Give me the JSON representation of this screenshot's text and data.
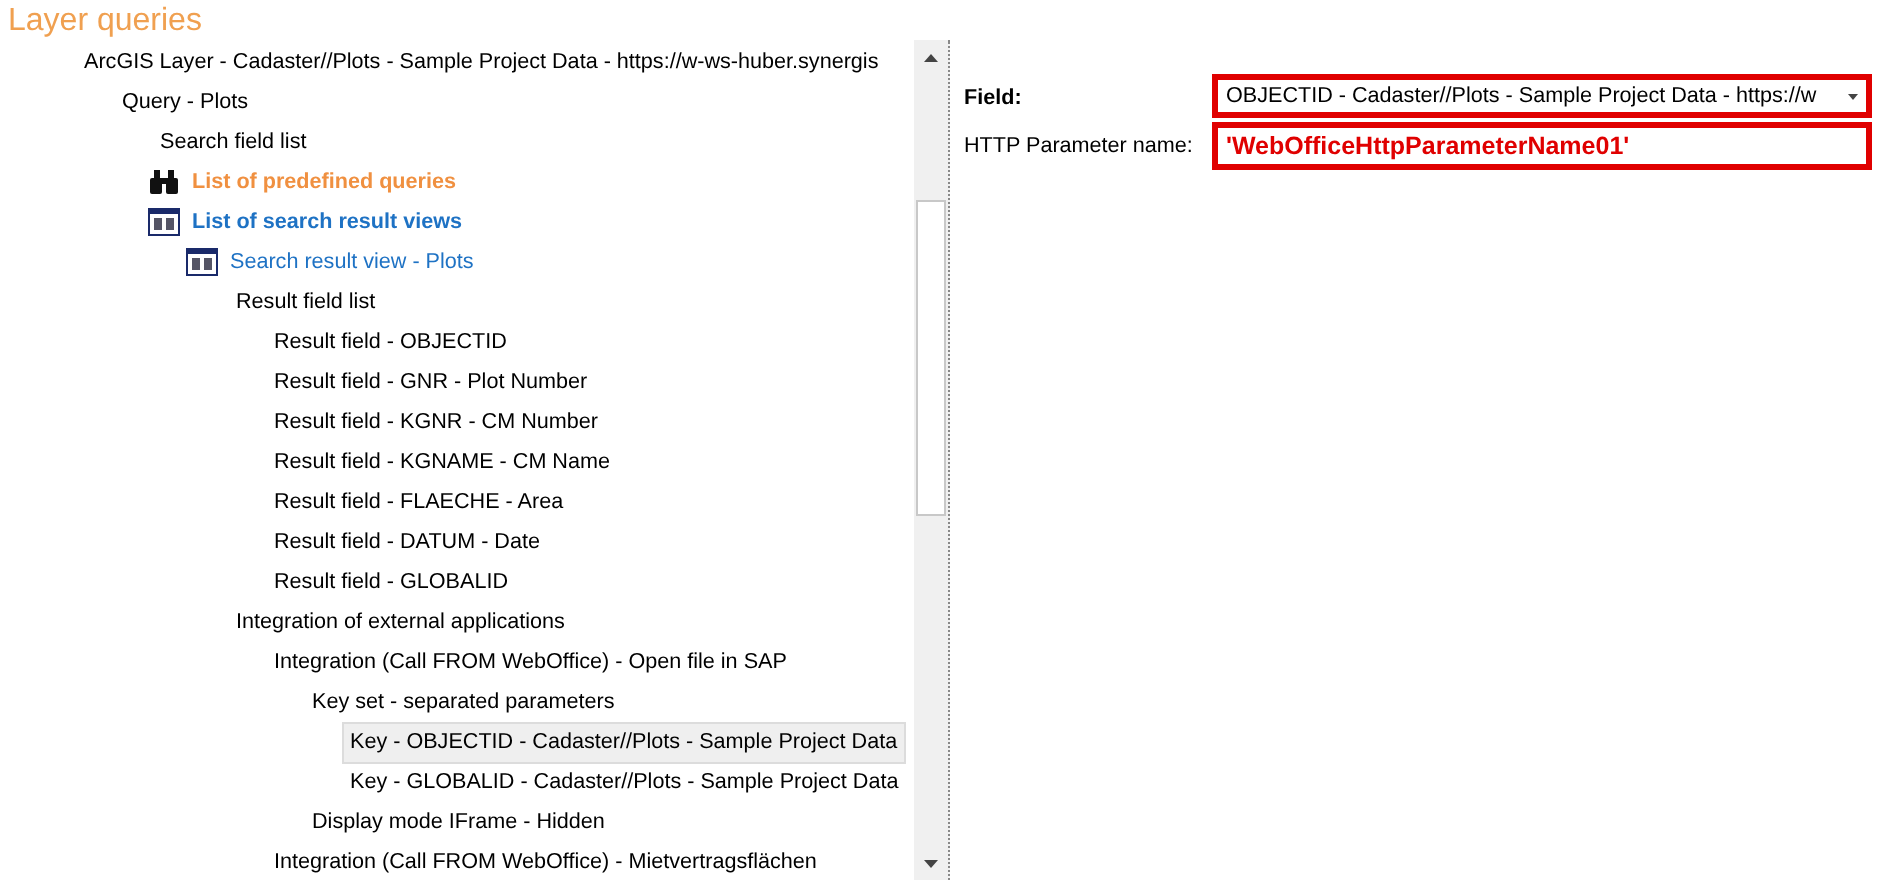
{
  "title": "Layer queries",
  "tree": [
    {
      "label": "ArcGIS Layer - Cadaster//Plots - Sample Project Data - https://w-ws-huber.synergis",
      "kind": "plain",
      "selected": false,
      "children": [
        {
          "label": "Query - Plots",
          "kind": "plain",
          "selected": false,
          "children": [
            {
              "label": "Search field list",
              "kind": "plain",
              "selected": false
            },
            {
              "label": "List of predefined queries",
              "kind": "query-list",
              "selected": false
            },
            {
              "label": "List of search result views",
              "kind": "view-list",
              "selected": false,
              "children": [
                {
                  "label": "Search result view - Plots",
                  "kind": "view",
                  "selected": false,
                  "children": [
                    {
                      "label": "Result field list",
                      "kind": "plain",
                      "selected": false,
                      "children": [
                        {
                          "label": "Result field - OBJECTID",
                          "kind": "plain",
                          "selected": false
                        },
                        {
                          "label": "Result field - GNR - Plot Number",
                          "kind": "plain",
                          "selected": false
                        },
                        {
                          "label": "Result field - KGNR - CM Number",
                          "kind": "plain",
                          "selected": false
                        },
                        {
                          "label": "Result field - KGNAME - CM Name",
                          "kind": "plain",
                          "selected": false
                        },
                        {
                          "label": "Result field - FLAECHE - Area",
                          "kind": "plain",
                          "selected": false
                        },
                        {
                          "label": "Result field - DATUM - Date",
                          "kind": "plain",
                          "selected": false
                        },
                        {
                          "label": "Result field - GLOBALID",
                          "kind": "plain",
                          "selected": false
                        }
                      ]
                    },
                    {
                      "label": "Integration of external applications",
                      "kind": "plain",
                      "selected": false,
                      "children": [
                        {
                          "label": "Integration (Call FROM WebOffice) - Open file in SAP",
                          "kind": "plain",
                          "selected": false,
                          "children": [
                            {
                              "label": "Key set - separated parameters",
                              "kind": "plain",
                              "selected": false,
                              "children": [
                                {
                                  "label": "Key - OBJECTID - Cadaster//Plots - Sample Project Data",
                                  "kind": "plain",
                                  "selected": true
                                },
                                {
                                  "label": "Key - GLOBALID - Cadaster//Plots - Sample Project Data",
                                  "kind": "plain",
                                  "selected": false
                                }
                              ]
                            },
                            {
                              "label": "Display mode IFrame - Hidden",
                              "kind": "plain",
                              "selected": false
                            }
                          ]
                        },
                        {
                          "label": "Integration (Call FROM WebOffice) - Mietvertragsflächen",
                          "kind": "plain",
                          "selected": false
                        }
                      ]
                    }
                  ]
                }
              ]
            }
          ]
        }
      ]
    }
  ],
  "form": [
    {
      "label": "Field:",
      "kind": "select",
      "value": "OBJECTID - Cadaster//Plots - Sample Project Data - https://w"
    },
    {
      "label": "HTTP Parameter name:",
      "kind": "text",
      "value": "'WebOfficeHttpParameterName01'"
    }
  ]
}
